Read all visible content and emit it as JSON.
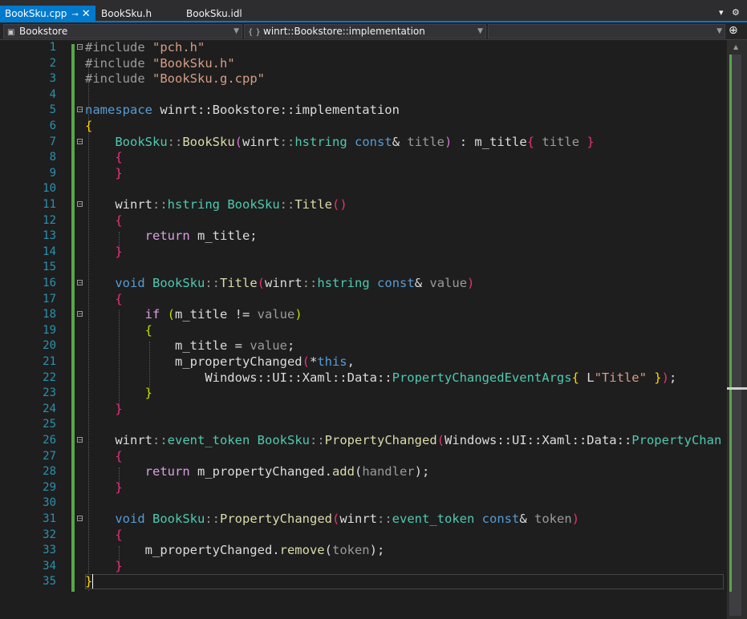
{
  "tabs": [
    {
      "label": "BookSku.cpp",
      "pin": "⊸",
      "close": "✕",
      "active": true
    },
    {
      "label": "BookSku.h",
      "active": false
    },
    {
      "label": "BookSku.idl",
      "active": false
    }
  ],
  "tab_controls": {
    "dropdown": "▾",
    "settings": "⚙"
  },
  "nav": {
    "project": "Bookstore",
    "scope_icon": "{ }",
    "scope": "winrt::Bookstore::implementation",
    "member": "",
    "split_icon": "⊕"
  },
  "editor": {
    "line_numbers": [
      "1",
      "2",
      "3",
      "4",
      "5",
      "6",
      "7",
      "8",
      "9",
      "10",
      "11",
      "12",
      "13",
      "14",
      "15",
      "16",
      "17",
      "18",
      "19",
      "20",
      "21",
      "22",
      "23",
      "24",
      "25",
      "26",
      "27",
      "28",
      "29",
      "30",
      "31",
      "32",
      "33",
      "34",
      "35"
    ],
    "code": {
      "l1_pp": "#include ",
      "l1_s": "\"pch.h\"",
      "l2_pp": "#include ",
      "l2_s": "\"BookSku.h\"",
      "l3_pp": "#include ",
      "l3_s": "\"BookSku.g.cpp\"",
      "ns_kw": "namespace",
      "ns_name": " winrt::Bookstore::implementation",
      "open": "{",
      "close": "}",
      "l7_type": "BookSku",
      "l7_sep": "::",
      "l7_fn": "BookSku",
      "l7_paren_o": "(",
      "l7_winrt": "winrt",
      "l7_hstring": "hstring",
      "l7_const": "const",
      "l7_amp": "& ",
      "l7_title": "title",
      "l7_paren_c": ")",
      "l7_colon": " : m_title",
      "l7_bo": "{",
      "l7_title2": " title ",
      "l7_bc": "}",
      "l11_winrt": "winrt",
      "l11_sep": "::",
      "l11_hstring": "hstring",
      "l11_type": "BookSku",
      "l11_fn": "Title",
      "l11_parens": "()",
      "l13_kw": "return",
      "l13_rest": " m_title;",
      "l16_void": "void",
      "l16_type": "BookSku",
      "l16_fn": "Title",
      "l16_po": "(",
      "l16_winrt": "winrt",
      "l16_hstring": "hstring",
      "l16_const": "const",
      "l16_amp": "& ",
      "l16_val": "value",
      "l16_pc": ")",
      "l18_if": "if",
      "l18_po": "(",
      "l18_mid": "m_title != ",
      "l18_val": "value",
      "l18_pc": ")",
      "l20_a": "m_title = ",
      "l20_val": "value",
      "l20_semi": ";",
      "l21_a": "m_propertyChanged",
      "l21_po": "(",
      "l21_star": "*",
      "l21_this": "this",
      "l21_comma": ",",
      "l22_ns": "Windows::UI::Xaml::Data::",
      "l22_type": "PropertyChangedEventArgs",
      "l22_bo": "{",
      "l22_L": " L",
      "l22_s": "\"Title\"",
      "l22_bc": " }",
      "l22_pc": ")",
      "l22_semi": ";",
      "l26_winrt": "winrt",
      "l26_sep": "::",
      "l26_tok": "event_token",
      "l26_type": "BookSku",
      "l26_fn": "PropertyChanged",
      "l26_po": "(",
      "l26_ns": "Windows::UI::Xaml::Data::",
      "l26_type2": "PropertyChan",
      "l28_kw": "return",
      "l28_a": " m_propertyChanged.",
      "l28_fn": "add",
      "l28_po": "(",
      "l28_h": "handler",
      "l28_pc": ")",
      "l28_semi": ";",
      "l31_void": "void",
      "l31_type": "BookSku",
      "l31_fn": "PropertyChanged",
      "l31_po": "(",
      "l31_winrt": "winrt",
      "l31_tok": "event_token",
      "l31_const": "const",
      "l31_amp": "& ",
      "l31_token": "token",
      "l31_pc": ")",
      "l33_a": "m_propertyChanged.",
      "l33_fn": "remove",
      "l33_po": "(",
      "l33_tok": "token",
      "l33_pc": ")",
      "l33_semi": ";",
      "l35": "}"
    }
  },
  "scrollbar": {
    "up_arrow": "▲"
  }
}
